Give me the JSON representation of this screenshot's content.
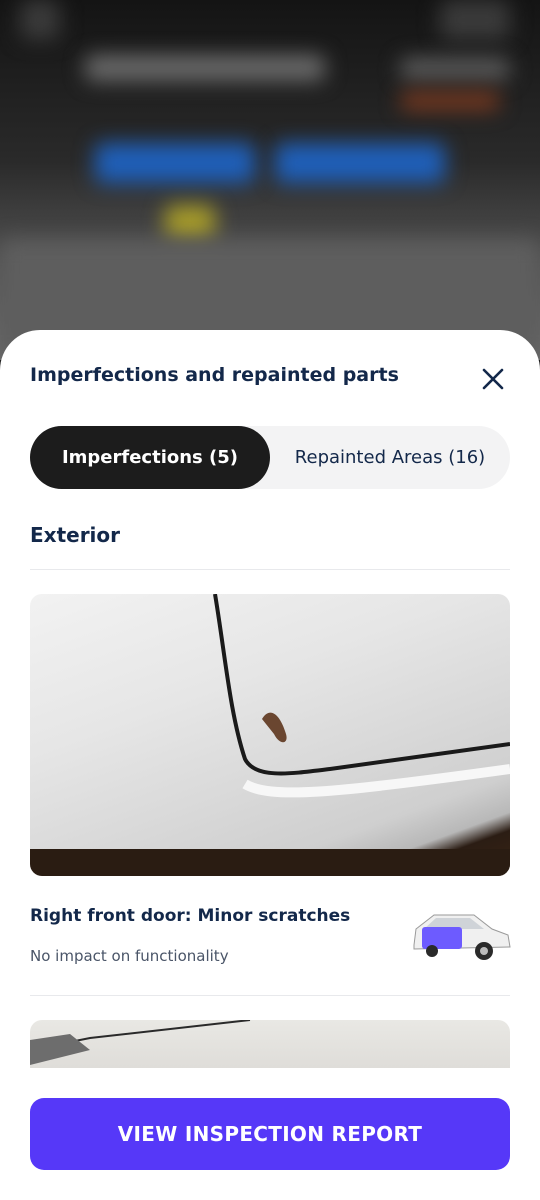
{
  "sheet": {
    "title": "Imperfections and repainted parts",
    "close_icon": "close-icon"
  },
  "tabs": [
    {
      "label": "Imperfections (5)",
      "active": true
    },
    {
      "label": "Repainted Areas (16)",
      "active": false
    }
  ],
  "section": {
    "title": "Exterior"
  },
  "items": [
    {
      "title": "Right front door: Minor scratches",
      "subtitle": "No impact on functionality",
      "thumb_icon": "car-right-front-door-icon",
      "highlight_color": "#6d5bff"
    }
  ],
  "cta": {
    "label": "VIEW INSPECTION REPORT",
    "color": "#5638f8"
  },
  "colors": {
    "title": "#13284a",
    "active_tab": "#1c1c1c"
  }
}
